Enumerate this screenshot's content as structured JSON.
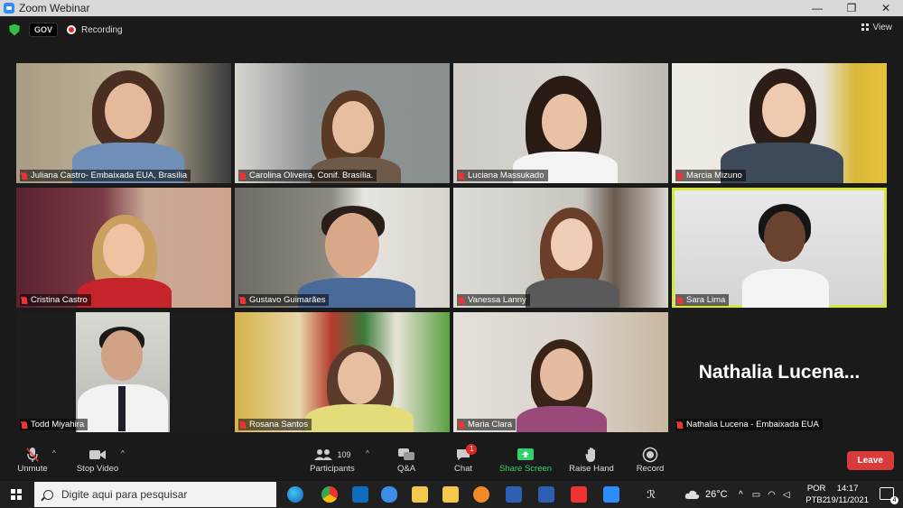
{
  "window": {
    "title": "Zoom Webinar",
    "controls": [
      "—",
      "❐",
      "✕"
    ]
  },
  "info_bar": {
    "gov_label": "GOV",
    "recording_label": "Recording",
    "view_label": "View"
  },
  "participants": [
    {
      "name": "Juliana Castro- Embaixada EUA, Brasília",
      "bg": "#b7a58a"
    },
    {
      "name": "Carolina Oliveira, Conif. Brasília.",
      "bg": "#9aa0a0"
    },
    {
      "name": "Luciana Massukado",
      "bg": "#c9c6c2"
    },
    {
      "name": "Marcia Mizuno",
      "bg": "#caa84c"
    },
    {
      "name": "Cristina Castro",
      "bg": "#6b2c34"
    },
    {
      "name": "Gustavo Guimarães",
      "bg": "#8c8a82"
    },
    {
      "name": "Vanessa Lanny",
      "bg": "#c7c4bf"
    },
    {
      "name": "Sara Lima",
      "bg": "#d8d8d8"
    },
    {
      "name": "Todd Miyahira",
      "bg": "#1c1c1c"
    },
    {
      "name": "Rosana Santos",
      "bg": "#c9a04a"
    },
    {
      "name": "Maria Clara",
      "bg": "#d8d0c6"
    },
    {
      "name": "Nathalia Lucena - Embaixada EUA",
      "bg": "#1a1a1a"
    }
  ],
  "large_name": "Nathalia  Lucena...",
  "toolbar": {
    "unmute_label": "Unmute",
    "stop_video_label": "Stop Video",
    "participants_label": "Participants",
    "participants_count": "109",
    "qa_label": "Q&A",
    "chat_label": "Chat",
    "chat_badge": "1",
    "share_label": "Share Screen",
    "raise_hand_label": "Raise Hand",
    "record_label": "Record",
    "leave_label": "Leave"
  },
  "taskbar": {
    "search_placeholder": "Digite aqui para pesquisar",
    "weather": "26°C",
    "lang_top": "POR",
    "lang_bottom": "PTB2",
    "time": "14:17",
    "date": "19/11/2021",
    "notifications": "4"
  },
  "colors": {
    "active_speaker": "#d8e83a",
    "leave": "#d93a3a",
    "share": "#2fd36b"
  }
}
